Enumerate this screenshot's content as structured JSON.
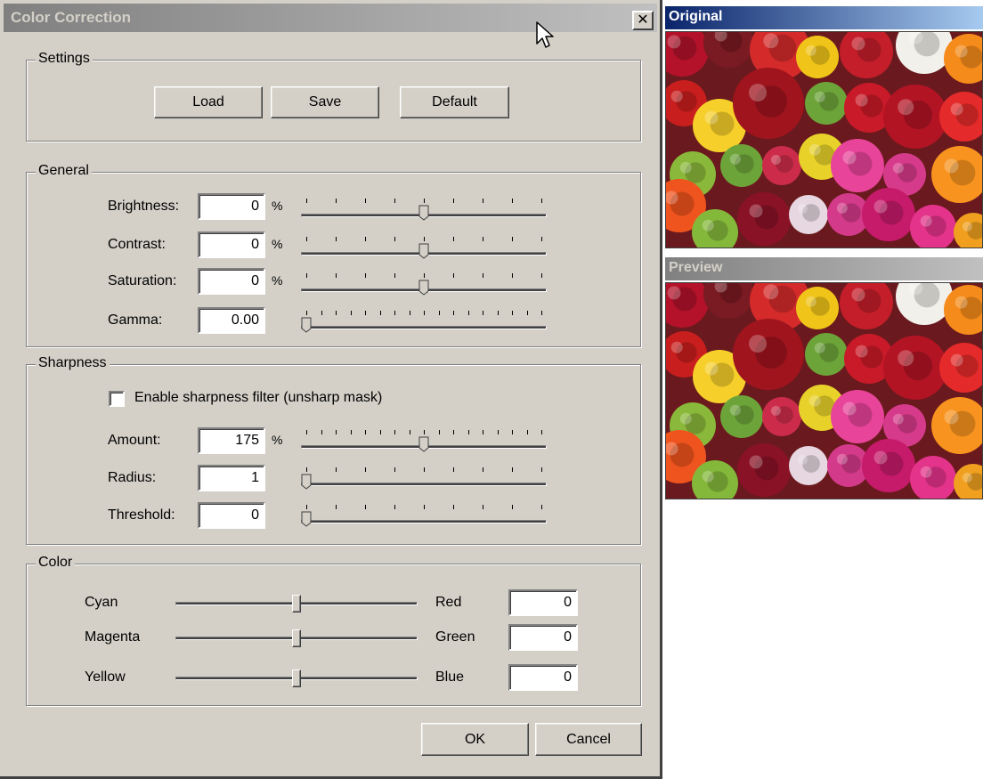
{
  "dialog": {
    "title": "Color Correction",
    "close_glyph": "✕"
  },
  "settings": {
    "legend": "Settings",
    "load": "Load",
    "save": "Save",
    "default": "Default"
  },
  "general": {
    "legend": "General",
    "brightness": {
      "label": "Brightness:",
      "value": "0",
      "unit": "%",
      "level": 0.5
    },
    "contrast": {
      "label": "Contrast:",
      "value": "0",
      "unit": "%",
      "level": 0.5
    },
    "saturation": {
      "label": "Saturation:",
      "value": "0",
      "unit": "%",
      "level": 0.5
    },
    "gamma": {
      "label": "Gamma:",
      "value": "0.00",
      "level": 0.0
    }
  },
  "sharpness": {
    "legend": "Sharpness",
    "enable_label": "Enable sharpness filter (unsharp mask)",
    "enabled": false,
    "amount": {
      "label": "Amount:",
      "value": "175",
      "unit": "%",
      "level": 0.5
    },
    "radius": {
      "label": "Radius:",
      "value": "1",
      "level": 0.0
    },
    "threshold": {
      "label": "Threshold:",
      "value": "0",
      "level": 0.0
    }
  },
  "color": {
    "legend": "Color",
    "rows": [
      {
        "left": "Cyan",
        "right": "Red",
        "value": "0",
        "level": 0.5
      },
      {
        "left": "Magenta",
        "right": "Green",
        "value": "0",
        "level": 0.5
      },
      {
        "left": "Yellow",
        "right": "Blue",
        "value": "0",
        "level": 0.5
      }
    ]
  },
  "buttons": {
    "ok": "OK",
    "cancel": "Cancel"
  },
  "panels": {
    "original": "Original",
    "preview": "Preview"
  },
  "colors": {
    "dialog_bg": "#d4d0c8",
    "active_title": "#0a246a",
    "active_title_end": "#a6caf0",
    "inactive_title": "#808080",
    "inactive_title_end": "#c0c0c0"
  },
  "icons": {
    "cursor": "mouse-pointer-icon",
    "close": "close-icon"
  }
}
